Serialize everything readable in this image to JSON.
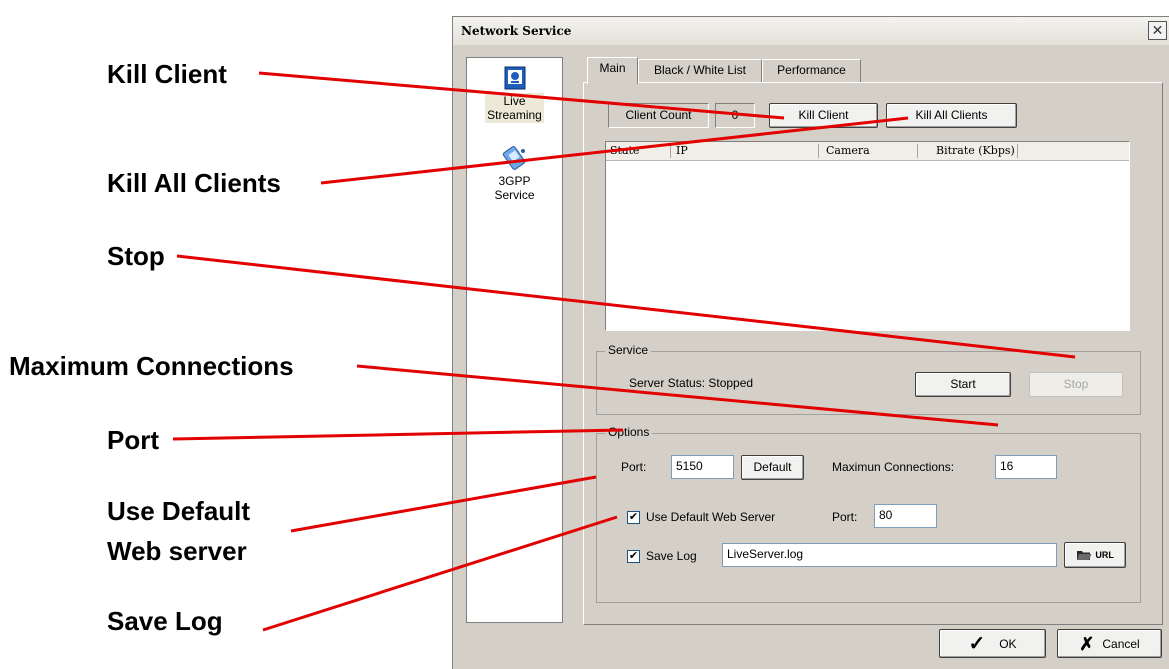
{
  "callouts": {
    "kill_client": "Kill Client",
    "kill_all_clients": "Kill All Clients",
    "stop": "Stop",
    "maximum_connections": "Maximum Connections",
    "port": "Port",
    "use_default_line1": "Use Default",
    "use_default_line2": "Web server",
    "save_log": "Save Log"
  },
  "window": {
    "title": "Network Service",
    "close_glyph": "✕"
  },
  "left_nav": [
    {
      "label_line1": "Live",
      "label_line2": "Streaming",
      "icon": "live-streaming-icon",
      "selected": true
    },
    {
      "label_line1": "3GPP",
      "label_line2": "Service",
      "icon": "3gpp-service-icon",
      "selected": false
    }
  ],
  "tabs": [
    "Main",
    "Black / White List",
    "Performance"
  ],
  "clients": {
    "count_label": "Client Count",
    "count_value": "0",
    "kill_client_button": "Kill Client",
    "kill_all_button": "Kill All Clients"
  },
  "client_table": {
    "columns": [
      "State",
      "IP",
      "Camera",
      "Bitrate (Kbps)"
    ],
    "rows": []
  },
  "service": {
    "group_label": "Service",
    "status_text": "Server Status: Stopped",
    "start_button": "Start",
    "stop_button": "Stop"
  },
  "options": {
    "group_label": "Options",
    "port_label": "Port:",
    "port_value": "5150",
    "default_button": "Default",
    "max_conn_label": "Maximun Connections:",
    "max_conn_value": "16",
    "use_default_web_label": "Use Default Web Server",
    "use_default_web_checked": true,
    "web_port_label": "Port:",
    "web_port_value": "80",
    "save_log_label": "Save Log",
    "save_log_checked": true,
    "log_file_value": "LiveServer.log",
    "url_button": "URL"
  },
  "footer": {
    "ok_button": "OK",
    "cancel_button": "Cancel"
  },
  "colors": {
    "leader_line": "#e30000",
    "dialog_face": "#d4d0c8"
  }
}
